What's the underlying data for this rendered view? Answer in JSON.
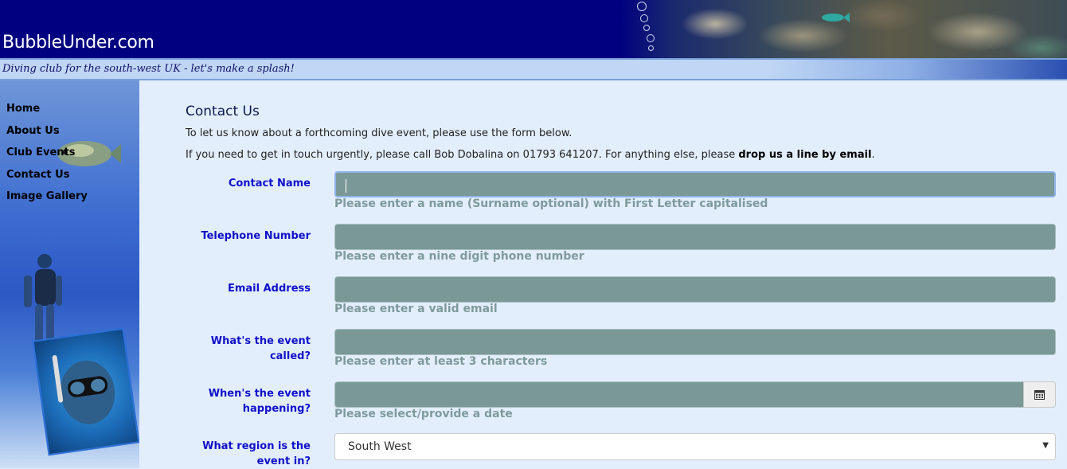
{
  "header": {
    "site_name": "BubbleUnder.com",
    "tagline": "Diving club for the south-west UK - let's make a splash!"
  },
  "nav": {
    "items": [
      {
        "label": "Home"
      },
      {
        "label": "About Us"
      },
      {
        "label": "Club Events"
      },
      {
        "label": "Contact Us"
      },
      {
        "label": "Image Gallery"
      }
    ]
  },
  "main": {
    "title": "Contact Us",
    "intro": "To let us know about a forthcoming dive event, please use the form below.",
    "urgent_prefix": "If you need to get in touch urgently, please call Bob Dobalina on 01793 641207. For anything else, please ",
    "urgent_link": "drop us a line by email",
    "urgent_suffix": "."
  },
  "form": {
    "contact_name": {
      "label": "Contact Name",
      "value": "",
      "help": "Please enter a name (Surname optional) with First Letter capitalised"
    },
    "telephone": {
      "label": "Telephone Number",
      "value": "",
      "help": "Please enter a nine digit phone number"
    },
    "email": {
      "label": "Email Address",
      "value": "",
      "help": "Please enter a valid email"
    },
    "event_name": {
      "label_line1": "What's the event",
      "label_line2": "called?",
      "value": "",
      "help": "Please enter at least 3 characters"
    },
    "event_date": {
      "label_line1": "When's the event",
      "label_line2": "happening?",
      "value": "",
      "help": "Please select/provide a date"
    },
    "region": {
      "label_line1": "What region is the",
      "label_line2": "event in?",
      "selected": "South West"
    }
  },
  "colors": {
    "header_bg": "#000080",
    "input_bg": "#7a9996",
    "label_color": "#1010c8",
    "help_color": "#7e9a9c"
  },
  "icons": {
    "calendar": "calendar-icon",
    "dropdown": "chevron-down-icon"
  }
}
